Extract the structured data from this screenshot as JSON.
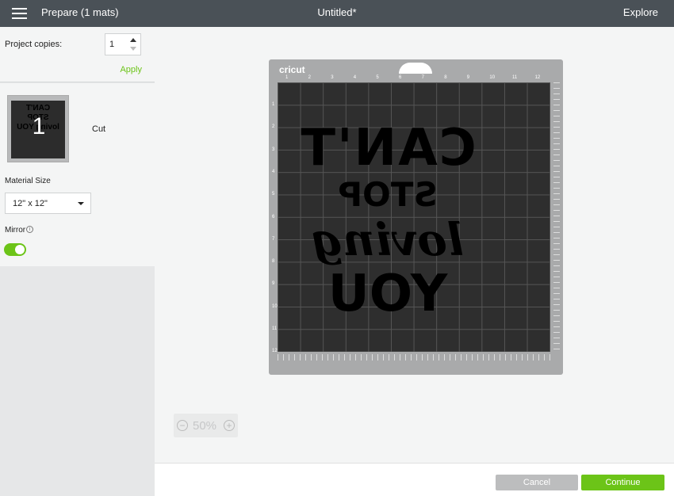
{
  "header": {
    "menu_icon": "hamburger-menu-icon",
    "prepare_label": "Prepare (1 mats)",
    "title": "Untitled*",
    "explore_label": "Explore"
  },
  "copies": {
    "label": "Project copies:",
    "value": "1",
    "apply_label": "Apply"
  },
  "mat_list": {
    "thumb_number": "1",
    "thumb_text": "CAN'T STOP loving YOU",
    "cut_label": "Cut",
    "material_size_label": "Material Size",
    "material_size_value": "12\" x 12\"",
    "mirror_label": "Mirror",
    "mirror_on": true
  },
  "mat": {
    "brand": "cricut",
    "ruler_top": [
      "1",
      "2",
      "3",
      "4",
      "5",
      "6",
      "7",
      "8",
      "9",
      "10",
      "11",
      "12"
    ],
    "ruler_left": [
      "1",
      "2",
      "3",
      "4",
      "5",
      "6",
      "7",
      "8",
      "9",
      "10",
      "11",
      "12"
    ],
    "design_lines": [
      "CAN'T",
      "STOP",
      "loving",
      "YOU"
    ]
  },
  "zoom": {
    "value": "50%",
    "minus": "−",
    "plus": "+"
  },
  "footer": {
    "cancel_label": "Cancel",
    "continue_label": "Continue"
  },
  "colors": {
    "accent": "#6cc418",
    "topbar": "#4a5157"
  }
}
